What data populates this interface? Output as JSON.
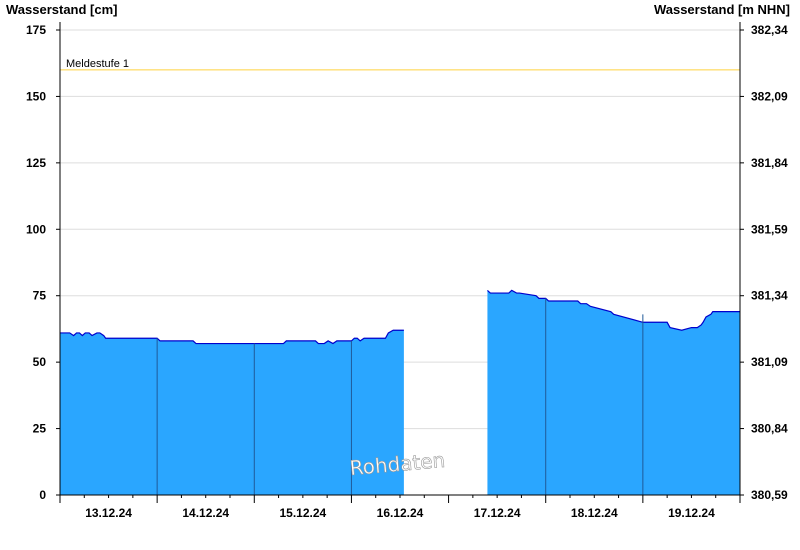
{
  "chart_data": {
    "type": "area",
    "left_ylabel": "Wasserstand [cm]",
    "right_ylabel": "Wasserstand [m NHN]",
    "ylim": [
      0,
      175
    ],
    "yticks": [
      0,
      25,
      50,
      75,
      100,
      125,
      150,
      175
    ],
    "right_ytick_labels": [
      "380,59",
      "380,84",
      "381,09",
      "381,34",
      "381,59",
      "381,84",
      "382,09",
      "382,34"
    ],
    "xlim": [
      0,
      7
    ],
    "x_tick_labels": [
      "13.12.24",
      "14.12.24",
      "15.12.24",
      "16.12.24",
      "17.12.24",
      "18.12.24",
      "19.12.24"
    ],
    "grid": true,
    "threshold": {
      "label": "Meldestufe 1",
      "value": 160,
      "color": "#ffd23f"
    },
    "watermark": "Rohdaten",
    "fill_color": "#2aa6ff",
    "line_color": "#0000cc",
    "segments": [
      {
        "x": [
          0.0,
          0.1,
          0.14,
          0.17,
          0.2,
          0.23,
          0.26,
          0.3,
          0.33,
          0.38,
          0.41,
          0.45,
          0.47,
          1.0,
          1.03,
          1.37,
          1.4,
          2.0,
          2.03,
          2.3,
          2.33,
          2.63,
          2.66,
          2.72,
          2.76,
          2.81,
          2.85,
          3.0,
          3.03,
          3.06,
          3.09,
          3.13,
          3.35,
          3.38,
          3.43,
          3.54
        ],
        "y": [
          61,
          61,
          60,
          61,
          61,
          60,
          61,
          61,
          60,
          61,
          61,
          60,
          59,
          59,
          58,
          58,
          57,
          57,
          57,
          57,
          58,
          58,
          57,
          57,
          58,
          57,
          58,
          58,
          59,
          59,
          58,
          59,
          59,
          61,
          62,
          62
        ]
      },
      {
        "x": [
          4.4,
          4.43,
          4.62,
          4.65,
          4.7,
          4.73,
          4.9,
          4.93,
          5.0,
          5.03,
          5.33,
          5.36,
          5.42,
          5.46,
          5.67,
          5.7,
          6.0,
          6.25,
          6.28,
          6.4,
          6.5,
          6.56,
          6.6,
          6.62,
          6.65,
          6.7,
          6.72,
          7.0
        ],
        "y": [
          77,
          76,
          76,
          77,
          76,
          76,
          75,
          74,
          74,
          73,
          73,
          72,
          72,
          71,
          69,
          68,
          65,
          65,
          63,
          62,
          63,
          63,
          64,
          65,
          67,
          68,
          69,
          69
        ]
      }
    ]
  }
}
